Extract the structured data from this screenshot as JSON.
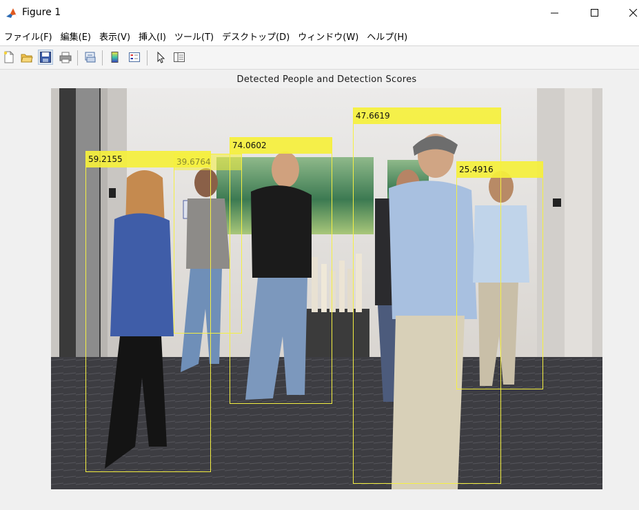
{
  "window": {
    "title": "Figure 1",
    "minimize_glyph": "─",
    "maximize_glyph": "☐",
    "close_glyph": "✕"
  },
  "menu": {
    "items": [
      {
        "label": "ファイル(F)"
      },
      {
        "label": "編集(E)"
      },
      {
        "label": "表示(V)"
      },
      {
        "label": "挿入(I)"
      },
      {
        "label": "ツール(T)"
      },
      {
        "label": "デスクトップ(D)"
      },
      {
        "label": "ウィンドウ(W)"
      },
      {
        "label": "ヘルプ(H)"
      }
    ]
  },
  "toolbar": {
    "icons": [
      "new-figure-icon",
      "open-file-icon",
      "save-icon",
      "print-icon",
      "link-plot-icon",
      "insert-colorbar-icon",
      "insert-legend-icon",
      "edit-plot-arrow-icon",
      "property-inspector-icon"
    ]
  },
  "figure": {
    "title": "Detected People and Detection Scores",
    "box_color": "#f5f042",
    "detections": [
      {
        "score": "59.2155"
      },
      {
        "score": "39.6764"
      },
      {
        "score": "74.0602"
      },
      {
        "score": "47.6619"
      },
      {
        "score": "25.4916"
      }
    ]
  }
}
